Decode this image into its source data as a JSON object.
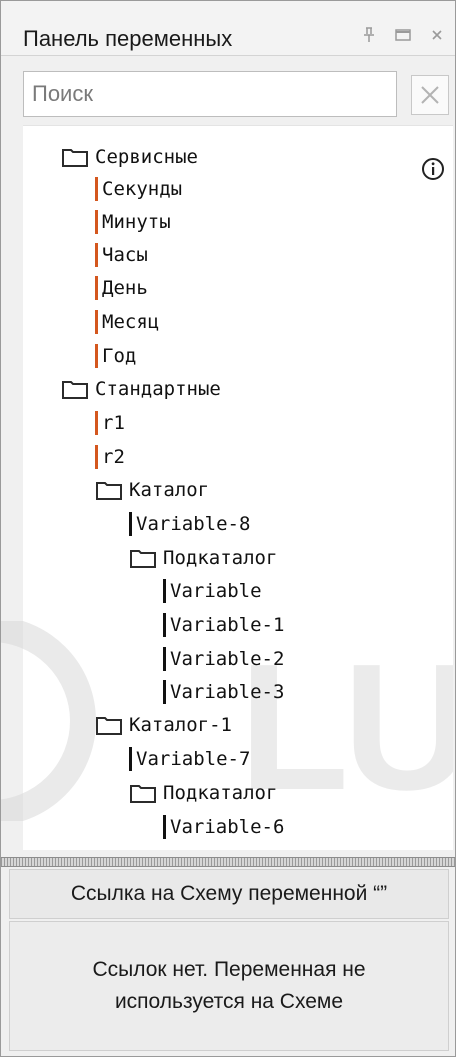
{
  "window": {
    "title": "Панель переменных",
    "pin_icon": "pin-icon",
    "maximize_icon": "window-icon",
    "close_icon": "close-icon"
  },
  "search": {
    "placeholder": "Поиск",
    "value": "",
    "clear_icon": "clear-x-icon"
  },
  "info_icon": "info-circle-icon",
  "colors": {
    "service_var_bar": "#d4571e",
    "user_var_bar": "#111111",
    "folder_stroke": "#2b2b2b"
  },
  "tree": [
    {
      "label": "Сервисные",
      "kind": "folder"
    },
    {
      "label": "Секунды",
      "kind": "service-var"
    },
    {
      "label": "Минуты",
      "kind": "service-var"
    },
    {
      "label": "Часы",
      "kind": "service-var"
    },
    {
      "label": "День",
      "kind": "service-var"
    },
    {
      "label": "Месяц",
      "kind": "service-var"
    },
    {
      "label": "Год",
      "kind": "service-var"
    },
    {
      "label": "Стандартные",
      "kind": "folder"
    },
    {
      "label": "r1",
      "kind": "service-var"
    },
    {
      "label": "r2",
      "kind": "service-var"
    },
    {
      "label": "Каталог",
      "kind": "folder"
    },
    {
      "label": "Variable-8",
      "kind": "var"
    },
    {
      "label": "Подкаталог",
      "kind": "folder"
    },
    {
      "label": "Variable",
      "kind": "var"
    },
    {
      "label": "Variable-1",
      "kind": "var"
    },
    {
      "label": "Variable-2",
      "kind": "var"
    },
    {
      "label": "Variable-3",
      "kind": "var"
    },
    {
      "label": "Каталог-1",
      "kind": "folder"
    },
    {
      "label": "Variable-7",
      "kind": "var"
    },
    {
      "label": "Подкаталог",
      "kind": "folder"
    },
    {
      "label": "Variable-6",
      "kind": "var"
    }
  ],
  "references": {
    "header": "Ссылка на Схему переменной “”",
    "empty_line1": "Ссылок нет. Переменная не",
    "empty_line2": "используется на Схеме"
  },
  "watermark_text": "LUND"
}
